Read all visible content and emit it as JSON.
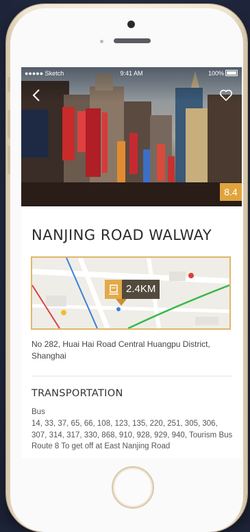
{
  "status_bar": {
    "carrier": "●●●●● Sketch",
    "time": "9:41 AM",
    "battery": "100%"
  },
  "hero": {
    "rating": "8.4",
    "icons": {
      "back": "chevron-left-icon",
      "favorite": "heart-icon"
    }
  },
  "place": {
    "title": "NANJING ROAD WALWAY",
    "distance": "2.4KM",
    "address": "No 282, Huai Hai Road Central Huangpu District, Shanghai"
  },
  "transportation": {
    "heading": "TRANSPORTATION",
    "mode": "Bus",
    "details": "14, 33, 37, 65, 66, 108, 123, 135, 220, 251, 305, 306, 307, 314, 317, 330, 868, 910, 928, 929, 940, Tourism Bus Route 8 To get off at East Nanjing Road"
  },
  "colors": {
    "accent": "#e0a43e",
    "background": "#262d45"
  }
}
